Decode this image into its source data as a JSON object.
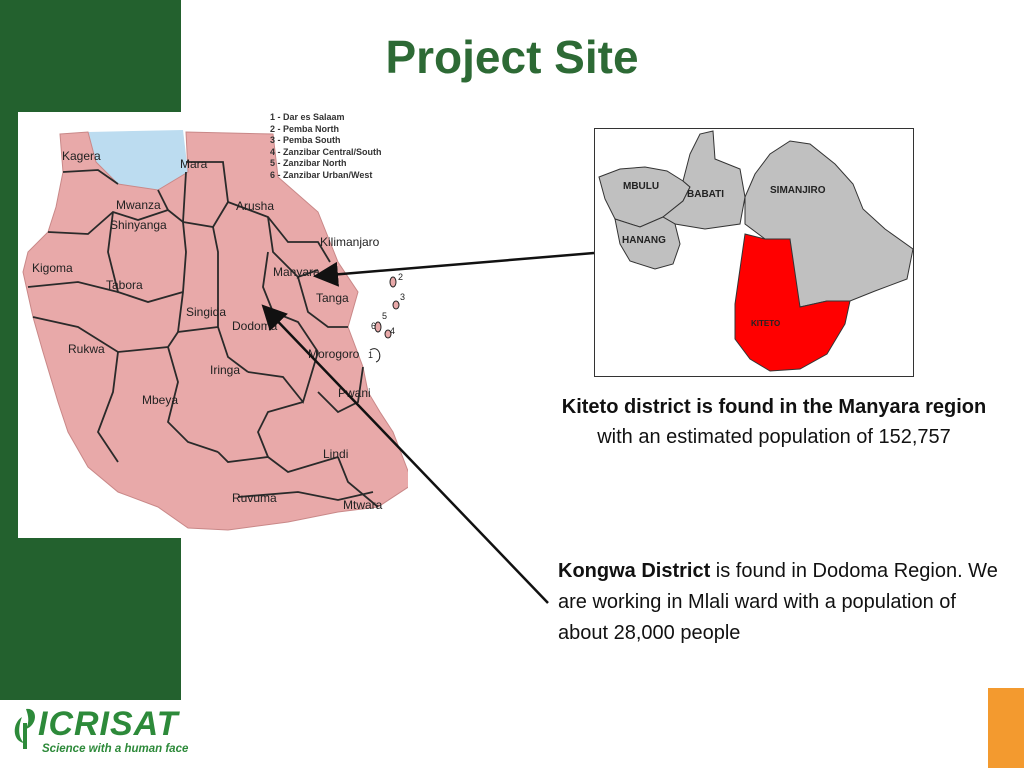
{
  "slide": {
    "title": "Project Site"
  },
  "map": {
    "legend": [
      "1 - Dar es Salaam",
      "2 - Pemba North",
      "3 - Pemba South",
      "4 - Zanzibar Central/South",
      "5 - Zanzibar North",
      "6 - Zanzibar Urban/West"
    ],
    "regions": {
      "kagera": "Kagera",
      "mara": "Mara",
      "mwanza": "Mwanza",
      "shinyanga": "Shinyanga",
      "arusha": "Arusha",
      "kilimanjaro": "Kilimanjaro",
      "kigoma": "Kigoma",
      "tabora": "Tabora",
      "manyara": "Manyara",
      "tanga": "Tanga",
      "singida": "Singida",
      "dodoma": "Dodoma",
      "rukwa": "Rukwa",
      "morogoro": "Morogoro",
      "iringa": "Iringa",
      "mbeya": "Mbeya",
      "pwani": "Pwani",
      "lindi": "Lindi",
      "ruvuma": "Ruvuma",
      "mtwara": "Mtwara"
    },
    "island_numbers": [
      "2",
      "3",
      "5",
      "6",
      "4",
      "1"
    ]
  },
  "inset": {
    "districts": {
      "mbulu": "MBULU",
      "babati": "BABATI",
      "simanjiro": "SIMANJIRO",
      "hanang": "HANANG",
      "kiteto": "KITETO"
    }
  },
  "captions": {
    "kiteto_bold": "Kiteto district is found in the Manyara region",
    "kiteto_rest": " with an estimated population of 152,757",
    "kongwa_bold": "Kongwa District",
    "kongwa_rest": " is found in Dodoma Region. We are working in Mlali ward with a population of about 28,000 people"
  },
  "logo": {
    "wordmark": "ICRISAT",
    "tagline": "Science with a human face"
  },
  "colors": {
    "sidebar_green": "#23612e",
    "title_green": "#2d6a35",
    "accent_orange": "#f39a2f",
    "map_pink": "#e8a9a9",
    "lake_blue": "#bcdcf0",
    "kiteto_red": "#ff0000",
    "district_gray": "#c0c0c0"
  }
}
